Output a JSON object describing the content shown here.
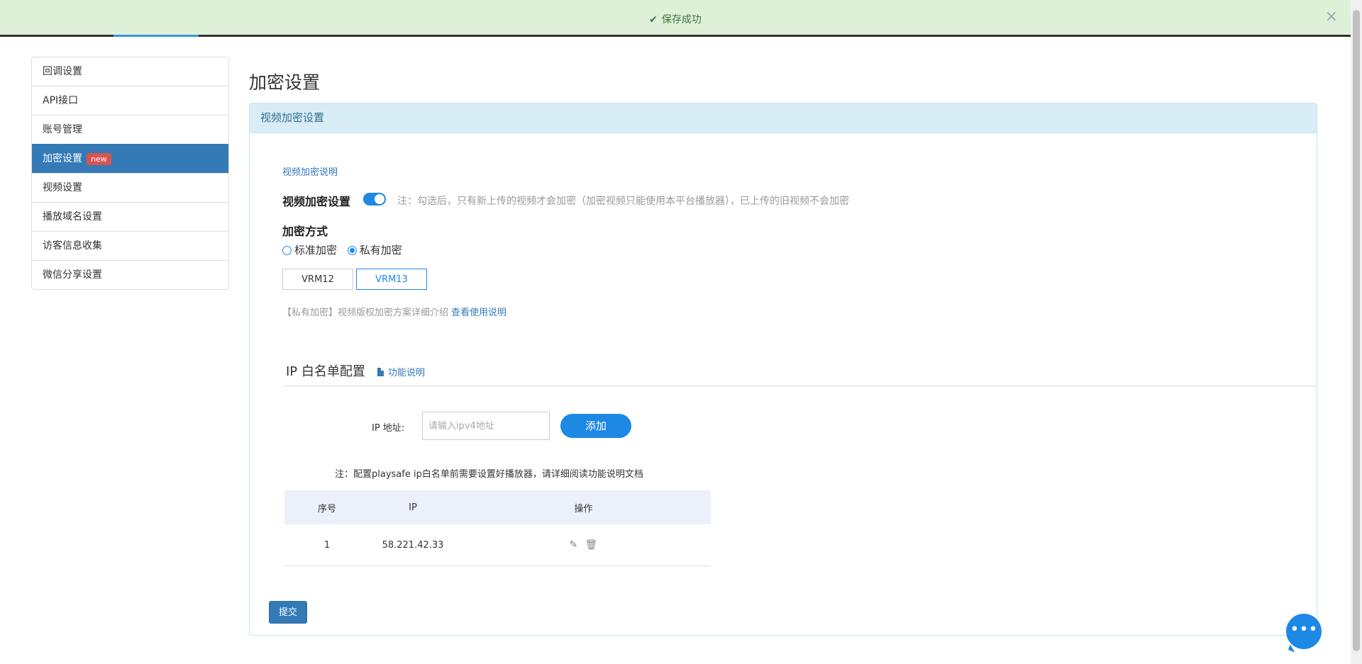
{
  "toast": {
    "message": "保存成功",
    "close": "×"
  },
  "sidebar": {
    "items": [
      {
        "label": "回调设置"
      },
      {
        "label": "API接口"
      },
      {
        "label": "账号管理"
      },
      {
        "label": "加密设置",
        "badge": "new",
        "active": true
      },
      {
        "label": "视频设置"
      },
      {
        "label": "播放域名设置"
      },
      {
        "label": "访客信息收集"
      },
      {
        "label": "微信分享设置"
      }
    ]
  },
  "main": {
    "title": "加密设置",
    "panel_title": "视频加密设置",
    "enc_desc_link": "视频加密说明",
    "enc_toggle_label": "视频加密设置",
    "enc_toggle_on": true,
    "enc_note": "注：勾选后，只有新上传的视频才会加密（加密视频只能使用本平台播放器），已上传的旧视频不会加密",
    "method_label": "加密方式",
    "methods": [
      {
        "label": "标准加密",
        "checked": false
      },
      {
        "label": "私有加密",
        "checked": true
      }
    ],
    "vrm": [
      {
        "label": "VRM12",
        "selected": false
      },
      {
        "label": "VRM13",
        "selected": true
      }
    ],
    "private_note": "【私有加密】视频版权加密方案详细介绍",
    "private_link": "查看使用说明",
    "ip_section": {
      "title": "IP 白名单配置",
      "doc_link": "功能说明",
      "ip_label": "IP 地址:",
      "ip_placeholder": "请输入ipv4地址",
      "add_button": "添加",
      "note": "注：配置playsafe ip白名单前需要设置好播放器，请详细阅读功能说明文档",
      "columns": [
        "序号",
        "IP",
        "操作"
      ],
      "rows": [
        {
          "index": "1",
          "ip": "58.221.42.33"
        }
      ]
    },
    "submit_button": "提交"
  },
  "colors": {
    "accent": "#1e88e5",
    "primary": "#337ab7",
    "toast_bg": "#dff0d8",
    "toast_text": "#3c763d",
    "panel_head_bg": "#d9edf7",
    "badge": "#d9534f"
  },
  "icons": {
    "toast": "check-icon",
    "close": "close-icon",
    "doc": "document-icon",
    "edit": "edit-icon",
    "delete": "trash-icon",
    "chat": "chat-icon"
  }
}
